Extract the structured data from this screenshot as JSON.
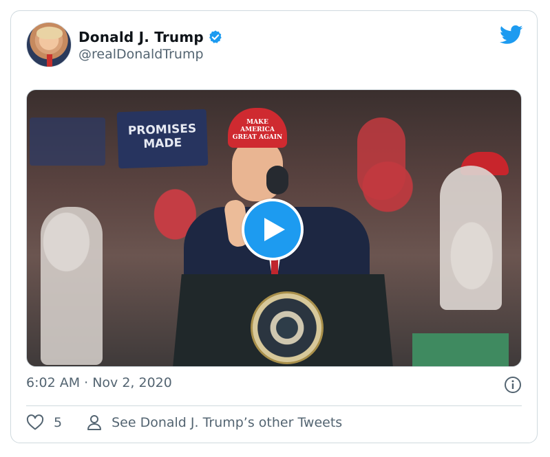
{
  "tweet": {
    "author_name": "Donald J. Trump",
    "author_handle": "@realDonaldTrump",
    "timestamp": "6:02 AM · Nov 2, 2020",
    "like_count": "5",
    "other_tweets_label": "See Donald J. Trump’s other Tweets"
  },
  "media": {
    "type": "video",
    "sign_text": "PROMISES MADE",
    "hat_text": "MAKE AMERICA GREAT AGAIN"
  },
  "icons": {
    "verified": "verified-badge-icon",
    "brand": "twitter-bird-icon",
    "play": "play-icon",
    "info": "info-icon",
    "like": "heart-icon",
    "profile": "person-icon"
  },
  "colors": {
    "accent": "#1d9bf0",
    "text_secondary": "#536471",
    "border": "#cfd9de"
  }
}
